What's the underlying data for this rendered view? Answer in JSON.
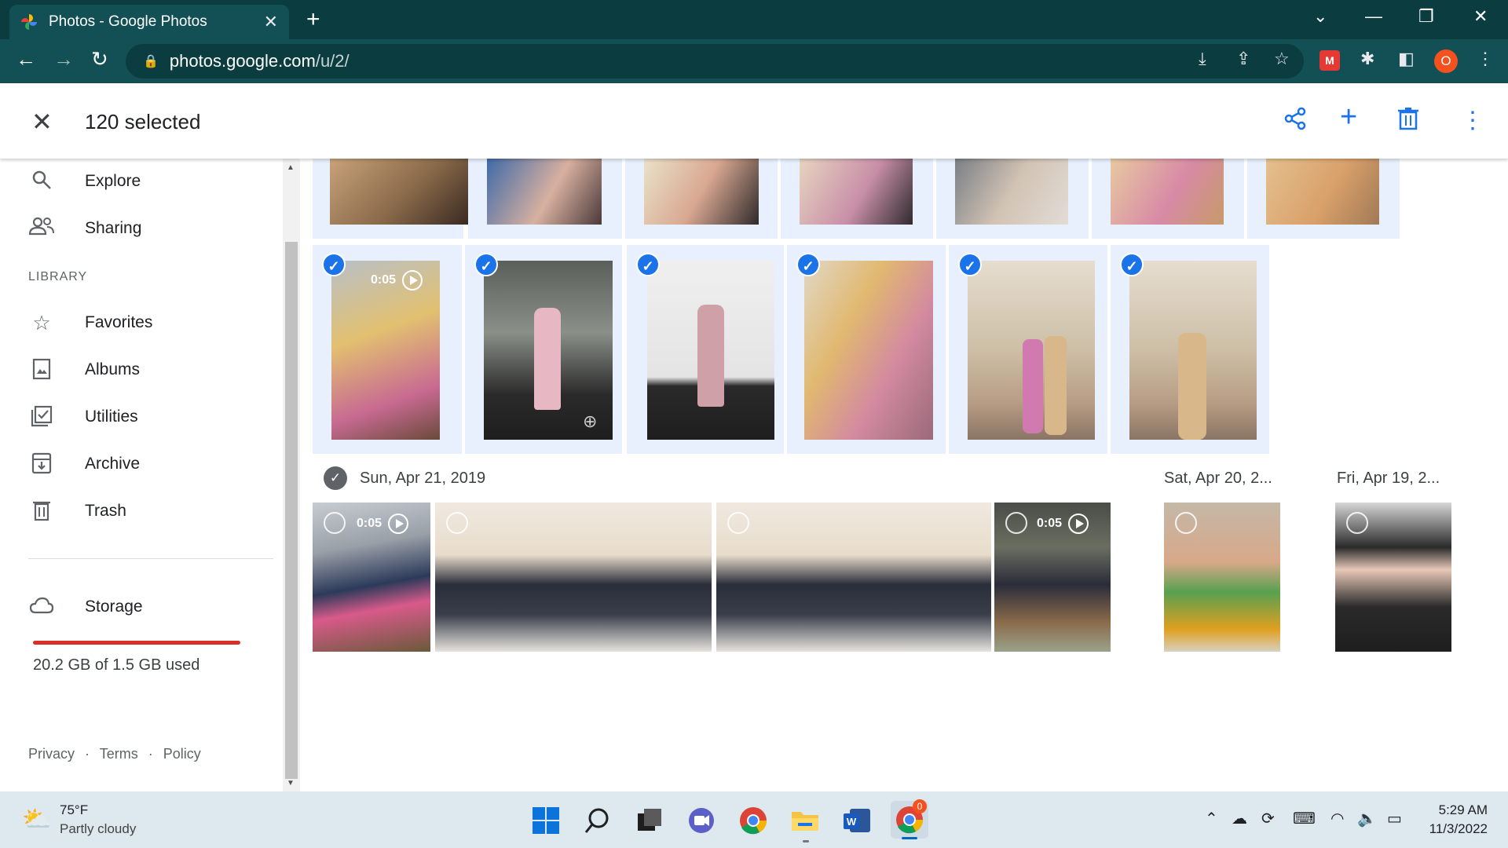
{
  "browser": {
    "tab_title": "Photos - Google Photos",
    "tab_close": "✕",
    "new_tab": "+",
    "url_host": "photos.google.com",
    "url_path": "/u/2/",
    "profile_initial": "O"
  },
  "header": {
    "selected_count": "120 selected"
  },
  "sidebar": {
    "items_top": [
      {
        "label": "Explore",
        "icon": "search-icon"
      },
      {
        "label": "Sharing",
        "icon": "people-icon"
      }
    ],
    "library_label": "LIBRARY",
    "library_items": [
      {
        "label": "Favorites",
        "icon": "star-icon"
      },
      {
        "label": "Albums",
        "icon": "album-icon"
      },
      {
        "label": "Utilities",
        "icon": "utilities-icon"
      },
      {
        "label": "Archive",
        "icon": "archive-icon"
      },
      {
        "label": "Trash",
        "icon": "trash-icon"
      }
    ],
    "storage_label": "Storage",
    "storage_used": "20.2 GB of 1.5 GB used",
    "footer": {
      "privacy": "Privacy",
      "terms": "Terms",
      "policy": "Policy",
      "sep": "·"
    }
  },
  "grid": {
    "videos": {
      "duration": "0:05"
    },
    "date_groups": [
      {
        "label": "Sun, Apr 21, 2019"
      },
      {
        "label": "Sat, Apr 20, 2..."
      },
      {
        "label": "Fri, Apr 19, 2..."
      }
    ]
  },
  "taskbar": {
    "temperature": "75°F",
    "condition": "Partly cloudy",
    "time": "5:29 AM",
    "date": "11/3/2022",
    "chrome_badge": "0"
  },
  "colors": {
    "accent": "#1a73e8",
    "selected_bg": "#e8f0fe",
    "chrome_dark": "#0b3d40",
    "storage_bar": "#d93025"
  }
}
